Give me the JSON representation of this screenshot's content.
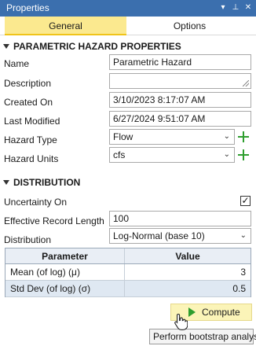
{
  "window": {
    "title": "Properties",
    "controls": [
      "▾",
      "⊥",
      "✕"
    ]
  },
  "tabs": [
    {
      "label": "General",
      "active": true
    },
    {
      "label": "Options",
      "active": false
    }
  ],
  "sections": {
    "hazard": "PARAMETRIC HAZARD PROPERTIES",
    "distribution": "DISTRIBUTION"
  },
  "fields": {
    "name": {
      "label": "Name",
      "value": "Parametric Hazard"
    },
    "description": {
      "label": "Description",
      "value": ""
    },
    "created_on": {
      "label": "Created On",
      "value": "3/10/2023 8:17:07 AM"
    },
    "last_modified": {
      "label": "Last Modified",
      "value": "6/27/2024 9:51:07 AM"
    },
    "hazard_type": {
      "label": "Hazard Type",
      "value": "Flow"
    },
    "hazard_units": {
      "label": "Hazard Units",
      "value": "cfs"
    },
    "uncertainty_on": {
      "label": "Uncertainty On",
      "checked": true,
      "mark": "✓"
    },
    "record_length": {
      "label": "Effective Record Length",
      "value": "100"
    },
    "distribution": {
      "label": "Distribution",
      "value": "Log-Normal (base 10)"
    }
  },
  "table": {
    "headers": [
      "Parameter",
      "Value"
    ],
    "rows": [
      {
        "parameter": "Mean (of log) (μ)",
        "value": "3"
      },
      {
        "parameter": "Std Dev (of log) (σ)",
        "value": "0.5"
      }
    ]
  },
  "compute": {
    "label": "Compute",
    "tooltip": "Perform bootstrap analysis"
  },
  "colors": {
    "titlebar": "#3b6fae",
    "tab_active": "#fbe98f",
    "accent_green": "#2e9e2e",
    "compute_bg": "#fbf4b8"
  },
  "icons": {
    "add": "plus-icon",
    "dropdown": "chevron-down-icon",
    "run": "play-icon",
    "pointer": "hand-cursor-icon"
  }
}
